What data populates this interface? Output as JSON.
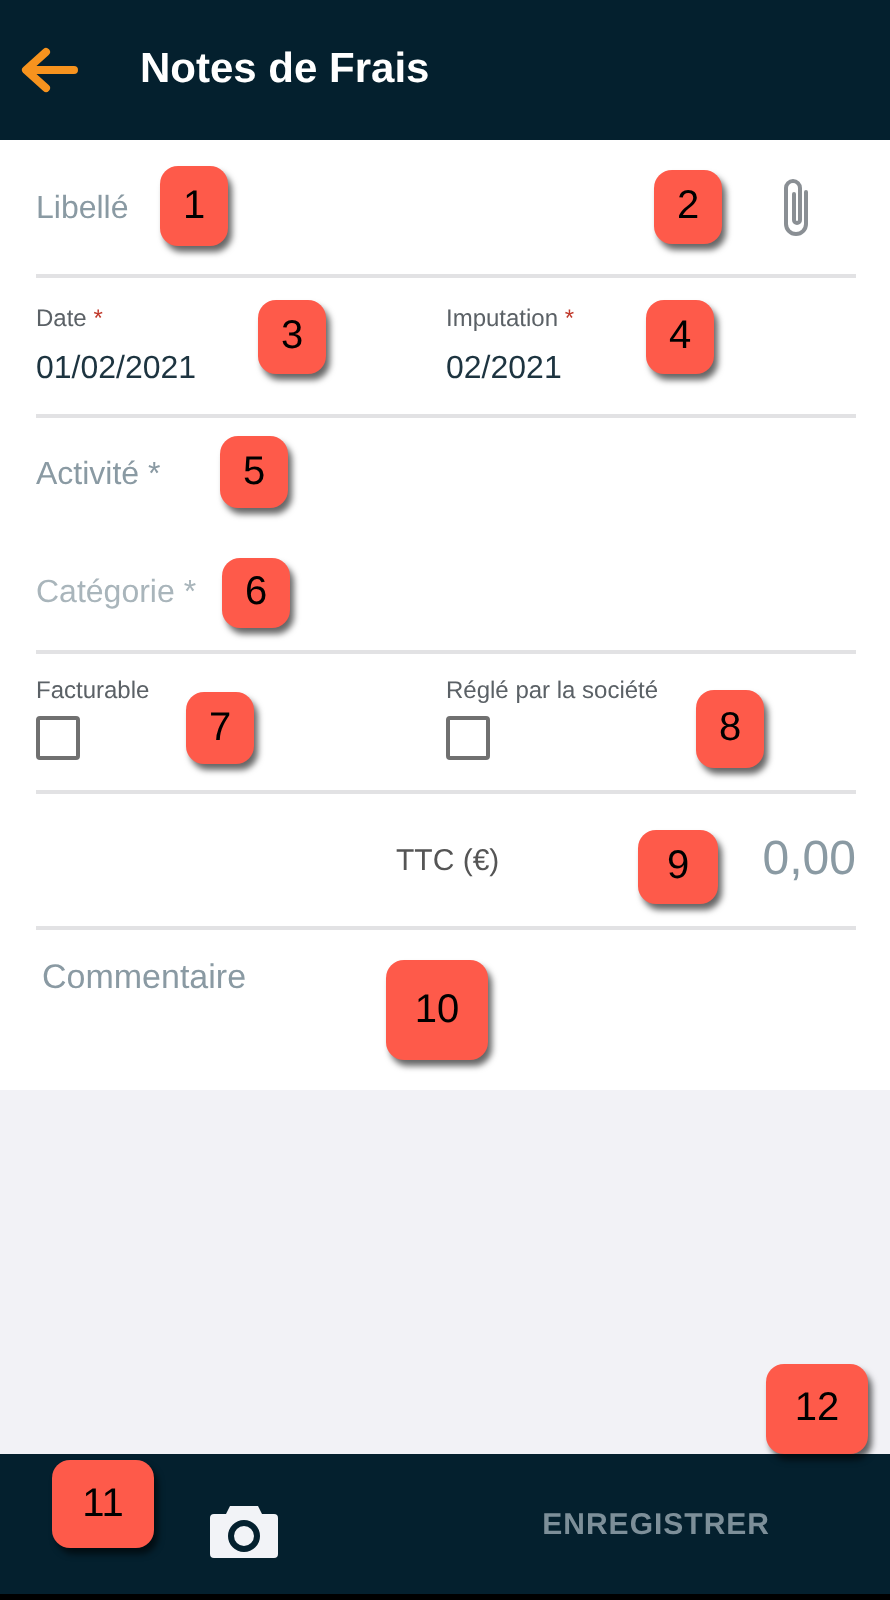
{
  "header": {
    "title": "Notes de Frais"
  },
  "form": {
    "libelle": {
      "placeholder": "Libellé"
    },
    "dates": [
      {
        "label": "Date",
        "marker": "*",
        "value": "01/02/2021"
      },
      {
        "label": "Imputation",
        "marker": "*",
        "value": "02/2021"
      }
    ],
    "selects": [
      {
        "placeholder": "Activité *",
        "disabled": false
      },
      {
        "placeholder": "Catégorie *",
        "disabled": true
      }
    ],
    "checkboxes": [
      {
        "label": "Facturable",
        "checked": false
      },
      {
        "label": "Réglé par la société",
        "checked": false
      }
    ],
    "total": {
      "label": "TTC (€)",
      "placeholder": "0,00"
    },
    "comment": {
      "placeholder": "Commentaire"
    }
  },
  "bottom_bar": {
    "save": {
      "label": "ENREGISTRER",
      "disabled": true
    }
  },
  "callouts": [
    "1",
    "2",
    "3",
    "4",
    "5",
    "6",
    "7",
    "8",
    "9",
    "10",
    "11",
    "12"
  ]
}
